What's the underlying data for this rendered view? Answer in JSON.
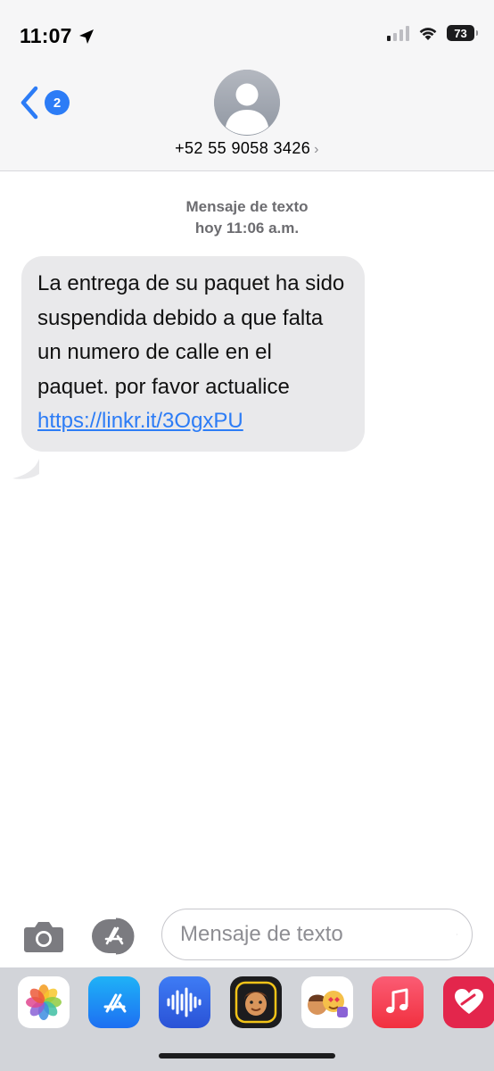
{
  "status_bar": {
    "time": "11:07",
    "battery": "73"
  },
  "nav": {
    "unread_count": "2",
    "contact_number": "+52 55 9058 3426",
    "contact_arrow": "›"
  },
  "conversation": {
    "service_label": "Mensaje de texto",
    "timestamp": "hoy 11:06 a.m.",
    "message_text": "La entrega de su paquet ha sido suspendida debido a que falta un numero de calle en el paquet. por favor actualice ",
    "message_link": "https://linkr.it/3OgxPU"
  },
  "composer": {
    "placeholder": "Mensaje de texto"
  },
  "app_drawer": {
    "apps": [
      "photos-icon",
      "app-store-icon",
      "audio-message-icon",
      "memoji-icon",
      "memoji-stickers-icon",
      "music-icon",
      "digital-touch-icon"
    ]
  },
  "colors": {
    "accent": "#2c7cf6",
    "bubble": "#e9e9eb",
    "header_bg": "#f6f6f7",
    "drawer_bg": "#d2d4d9"
  }
}
